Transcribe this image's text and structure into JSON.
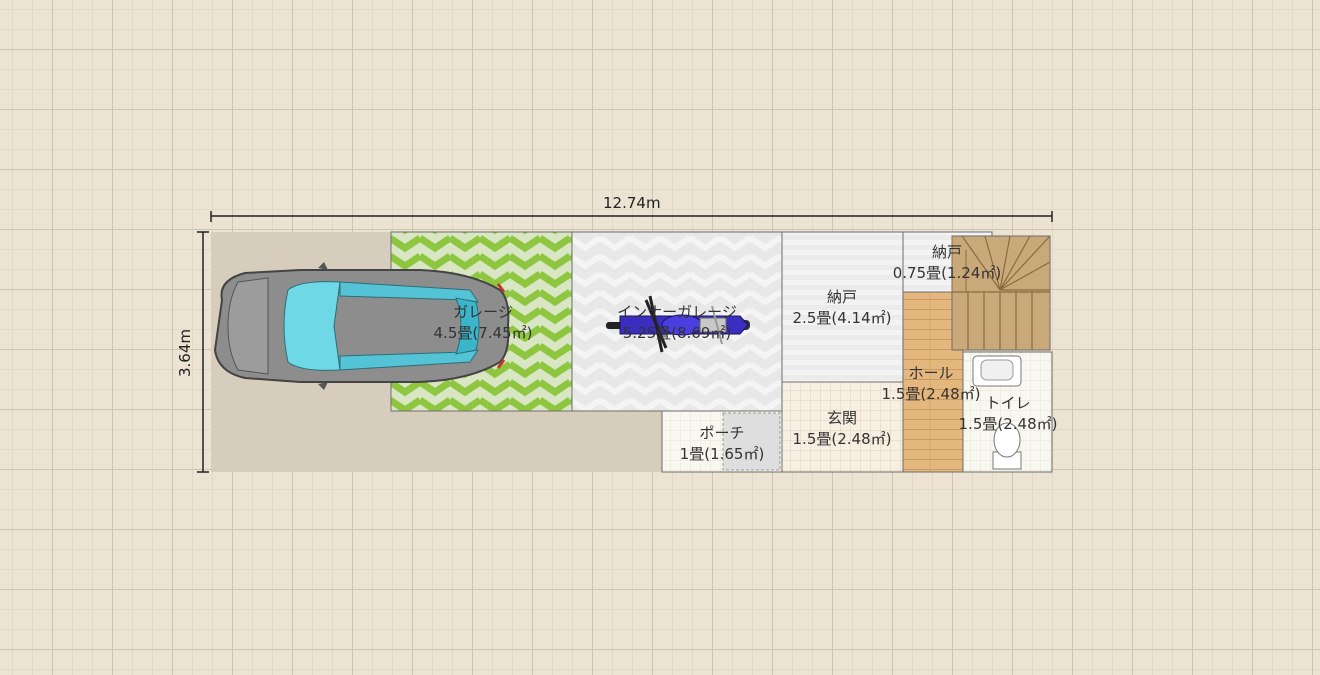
{
  "dimensions": {
    "width_label": "12.74m",
    "height_label": "3.64m"
  },
  "rooms": [
    {
      "id": "garage",
      "name": "ガレージ",
      "area": "4.5畳(7.45㎡)"
    },
    {
      "id": "inner_garage",
      "name": "インナーガレージ",
      "area": "5.25畳(8.69㎡)"
    },
    {
      "id": "storage_large",
      "name": "納戸",
      "area": "2.5畳(4.14㎡)"
    },
    {
      "id": "storage_small",
      "name": "納戸",
      "area": "0.75畳(1.24㎡)"
    },
    {
      "id": "hall",
      "name": "ホール",
      "area": "1.5畳(2.48㎡)"
    },
    {
      "id": "toilet",
      "name": "トイレ",
      "area": "1.5畳(2.48㎡)"
    },
    {
      "id": "entrance",
      "name": "玄関",
      "area": "1.5畳(2.48㎡)"
    },
    {
      "id": "porch",
      "name": "ポーチ",
      "area": "1畳(1.65㎡)"
    }
  ],
  "furniture": [
    {
      "id": "car",
      "icon": "car-icon"
    },
    {
      "id": "motorcycle",
      "icon": "motorcycle-icon"
    },
    {
      "id": "stairs",
      "icon": "stairs-icon"
    },
    {
      "id": "toilet_fixture",
      "icon": "toilet-icon"
    },
    {
      "id": "sink",
      "icon": "sink-icon"
    }
  ],
  "colors": {
    "background": "#ece3d3",
    "lot": "#d7cdbd",
    "garage_zigzag": "#8ec63f",
    "inner_garage": "#e6e6e6",
    "hall_wood": "#e0b37a",
    "car_glass": "#6fd8e6",
    "motorcycle": "#3a2dbf"
  }
}
